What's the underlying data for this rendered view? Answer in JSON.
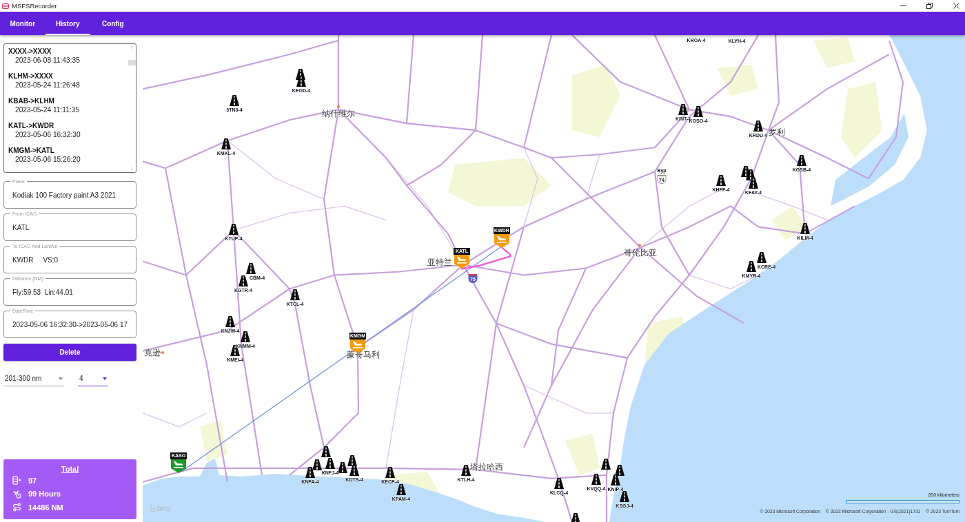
{
  "window": {
    "title": "MSFSRecorder"
  },
  "tabs": [
    {
      "label": "Monitor",
      "selected": false
    },
    {
      "label": "History",
      "selected": true
    },
    {
      "label": "Config",
      "selected": false
    }
  ],
  "flights": [
    {
      "route": "XXXX->XXXX",
      "time": "2023-06-08 11:43:35"
    },
    {
      "route": "KLHM->XXXX",
      "time": "2023-05-24 11:26:48"
    },
    {
      "route": "KBAB->KLHM",
      "time": "2023-05-24 11:11:35"
    },
    {
      "route": "KATL->KWDR",
      "time": "2023-05-06 16:32:30"
    },
    {
      "route": "KMGM->KATL",
      "time": "2023-05-06 15:26:20"
    }
  ],
  "details": [
    {
      "label": "Plane",
      "value": "Kodiak 100 Factory paint A3 2021"
    },
    {
      "label": "From ICAO",
      "value": "KATL"
    },
    {
      "label": "To ICAO And Landvs",
      "value": "KWDR     VS:0"
    },
    {
      "label": "Distance (NM)",
      "value": "Fly:59.53  Lin:44.01"
    },
    {
      "label": "DateTime",
      "value": "2023-05-06 16:32:30->2023-05-06 17"
    }
  ],
  "delete_button": "Delete",
  "filters": [
    {
      "value": "201-300 nm",
      "focused": false
    },
    {
      "value": "4",
      "focused": true
    }
  ],
  "total": {
    "title": "Total",
    "rows": [
      {
        "kind": "flights",
        "value": "97"
      },
      {
        "kind": "hours",
        "value": "99 Hours"
      },
      {
        "kind": "distance",
        "value": "14486 NM"
      }
    ]
  },
  "map": {
    "cities": [
      "纳什维尔",
      "亚特兰",
      "蒙哥马利",
      "克逊",
      "哥伦比亚",
      "罗利",
      "塔拉哈西"
    ],
    "road_shields": [
      {
        "kind": "interstate",
        "number": "75"
      },
      {
        "kind": "us_route",
        "prefix": "Byp",
        "number": "74"
      }
    ],
    "airports": [
      {
        "code": "KWDR",
        "color": "#f59a0c"
      },
      {
        "code": "KATL",
        "color": "#f59a0c"
      },
      {
        "code": "KMGM",
        "color": "#f59a0c"
      },
      {
        "code": "KASO",
        "color": "#1e9a2c"
      }
    ],
    "airfields": [
      {
        "kind": "runway"
      },
      {
        "kind": "runway",
        "label": "KEOD-4"
      },
      {
        "kind": "runway",
        "label": "3TN3-4"
      },
      {
        "kind": "runway",
        "label": "KMKL-4"
      },
      {
        "kind": "runway",
        "label": "KTUP-4"
      },
      {
        "kind": "runway",
        "label": "CBM-4"
      },
      {
        "kind": "runway",
        "label": "KGTR-4"
      },
      {
        "kind": "runway",
        "label": "KTCL-4"
      },
      {
        "kind": "runway",
        "label": "KNJW-4"
      },
      {
        "kind": "runway",
        "label": "KNMM-4"
      },
      {
        "kind": "runway",
        "label": "KMEI-4"
      },
      {
        "kind": "label",
        "label": "KROA-4"
      },
      {
        "kind": "label",
        "label": "KLYH-4"
      },
      {
        "kind": "runway",
        "label": "KINT-4"
      },
      {
        "kind": "runway",
        "label": "KGSO-4"
      },
      {
        "kind": "runway",
        "label": "KRDU-4"
      },
      {
        "kind": "runway",
        "label": "KGSB-4"
      },
      {
        "kind": "runway",
        "label": "KHFF-4"
      },
      {
        "kind": "runway"
      },
      {
        "kind": "runway"
      },
      {
        "kind": "runway",
        "label": "KFAY-4"
      },
      {
        "kind": "runway",
        "label": "KILM-4"
      },
      {
        "kind": "runway",
        "label": "KCRE-4"
      },
      {
        "kind": "runway",
        "label": "KMYR-4"
      },
      {
        "kind": "runway"
      },
      {
        "kind": "runway"
      },
      {
        "kind": "runway",
        "label": "KNPA-4"
      },
      {
        "kind": "runway"
      },
      {
        "kind": "runway",
        "label": "KNFJ-4"
      },
      {
        "kind": "runway"
      },
      {
        "kind": "runway",
        "label": "KDTS-4"
      },
      {
        "kind": "runway",
        "label": "KECP-4"
      },
      {
        "kind": "runway",
        "label": "KPAM-4"
      },
      {
        "kind": "runway",
        "label": "KTLH-4"
      },
      {
        "kind": "runway",
        "label": "KLCQ-4"
      },
      {
        "kind": "runway"
      },
      {
        "kind": "runway"
      },
      {
        "kind": "runway"
      },
      {
        "kind": "runway",
        "label": "KVQQ-4"
      },
      {
        "kind": "runway",
        "label": "KNIP-4"
      },
      {
        "kind": "runway",
        "label": "KSGJ-4"
      }
    ],
    "logo": "bing",
    "scale": "200 kilometers",
    "attributions": [
      "© 2023 Microsoft Corporation",
      "© 2023 Microsoft Corporation - GS(2021)1731",
      "© 2023 TomTom"
    ]
  }
}
